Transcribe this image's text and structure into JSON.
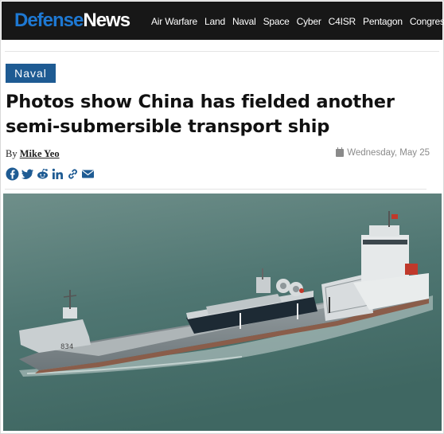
{
  "site": {
    "brand_part1": "Defense",
    "brand_part2": "News"
  },
  "nav": {
    "items": [
      "Air Warfare",
      "Land",
      "Naval",
      "Space",
      "Cyber",
      "C4ISR",
      "Pentagon",
      "Congress"
    ]
  },
  "article": {
    "category": "Naval",
    "headline": "Photos show China has fielded another semi-submersible transport ship",
    "byline_prefix": "By",
    "author": "Mike Yeo",
    "date": "Wednesday, May 25"
  },
  "share": {
    "icons": [
      "facebook-icon",
      "twitter-icon",
      "reddit-icon",
      "linkedin-icon",
      "link-icon",
      "email-icon"
    ]
  },
  "photo": {
    "hull_number": "834"
  },
  "colors": {
    "brand_blue": "#1e78d2",
    "tag_bg": "#1e5b93",
    "topbar_bg": "#171717",
    "share_blue": "#1e5b93"
  }
}
